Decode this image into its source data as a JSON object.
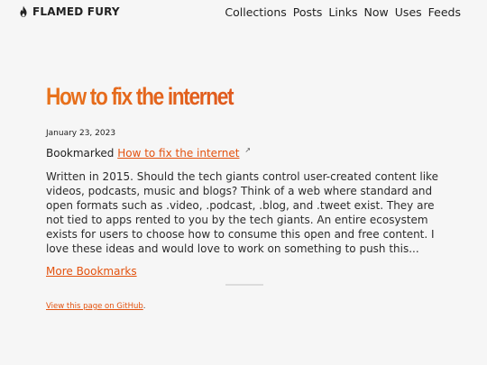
{
  "header": {
    "brand": {
      "name": "FLAMED FURY",
      "icon": "flame-icon"
    },
    "nav": [
      "Collections",
      "Posts",
      "Links",
      "Now",
      "Uses",
      "Feeds"
    ]
  },
  "post": {
    "title": "How to fix the internet",
    "date": "January 23, 2023",
    "bookmark_prefix": "Bookmarked",
    "bookmark_link": "How to fix the internet",
    "external_icon": "external-link-icon",
    "description": "Written in 2015. Should the tech giants control user-created content like videos, podcasts, music and blogs? Think of a web where standard and open formats such as .video, .podcast, .blog, and .tweet exist. They are not tied to apps rented to you by the tech giants. An entire ecosystem exists for users to choose how to consume this open and free content. I love these ideas and would love to work on something to push this...",
    "more_link": "More Bookmarks"
  },
  "footer": {
    "github_link": "View this page on GitHub",
    "suffix": "."
  },
  "colors": {
    "accent": "#e3520e",
    "title_gradient_start": "#e8731b",
    "title_gradient_end": "#d8311e",
    "background": "#f6f6f6"
  }
}
